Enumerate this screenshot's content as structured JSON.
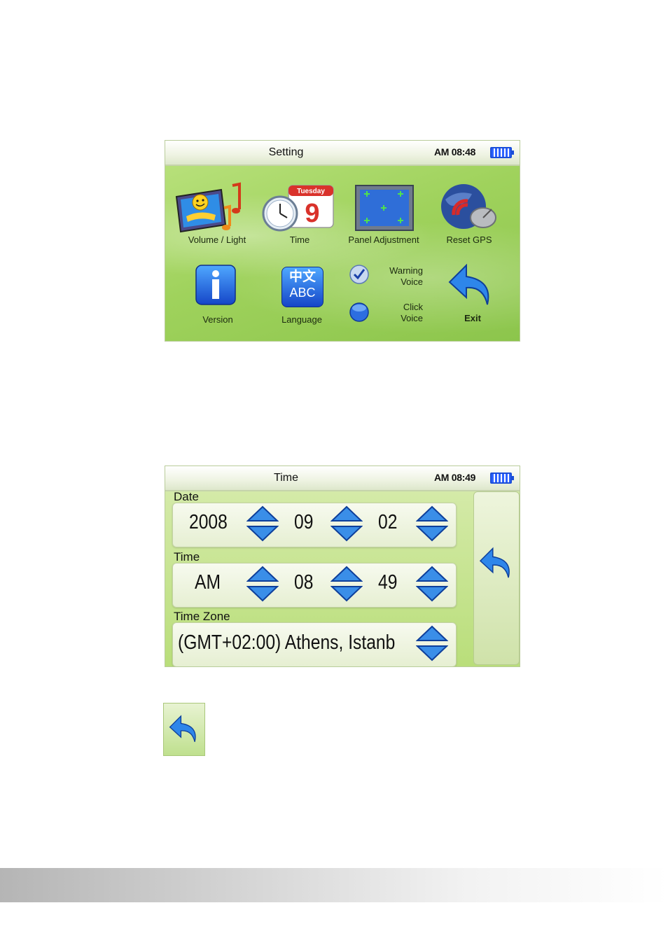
{
  "setting_screen": {
    "title": "Setting",
    "clock": "AM 08:48",
    "items": {
      "volume_light": "Volume / Light",
      "time": "Time",
      "panel_adjustment": "Panel Adjustment",
      "reset_gps": "Reset GPS",
      "version": "Version",
      "language": "Language",
      "warning_voice": "Warning\nVoice",
      "click_voice": "Click\nVoice",
      "exit": "Exit"
    },
    "calendar_day": "Tuesday",
    "calendar_date": "9",
    "language_icon_top": "中文",
    "language_icon_bottom": "ABC",
    "warning_voice_checked": true,
    "click_voice_checked": false
  },
  "time_screen": {
    "title": "Time",
    "clock": "AM 08:49",
    "date_label": "Date",
    "date": {
      "year": "2008",
      "month": "09",
      "day": "02"
    },
    "time_label": "Time",
    "time": {
      "ampm": "AM",
      "hour": "08",
      "minute": "49"
    },
    "timezone_label": "Time Zone",
    "timezone_value": "(GMT+02:00) Athens, Istanb"
  },
  "colors": {
    "screen_green": "#9fd25c",
    "accent_blue": "#2d63ff",
    "arrow_blue": "#3a8ee8"
  },
  "icons": [
    "volume-light-icon",
    "clock-calendar-icon",
    "panel-adjustment-icon",
    "gps-satellite-icon",
    "info-icon",
    "language-icon",
    "check-radio-icon",
    "exit-arrow-icon",
    "up-down-arrows-icon",
    "back-arrow-icon"
  ]
}
